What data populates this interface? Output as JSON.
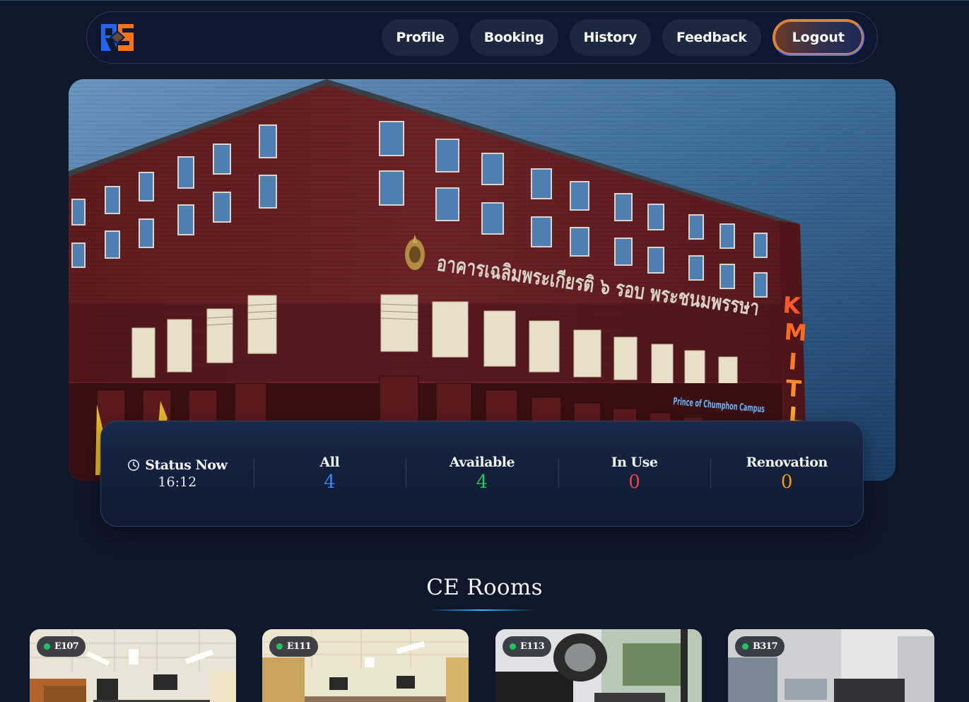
{
  "nav": {
    "logo_alt": "RS",
    "items": [
      {
        "label": "Profile"
      },
      {
        "label": "Booking"
      },
      {
        "label": "History"
      },
      {
        "label": "Feedback"
      }
    ],
    "logout_label": "Logout"
  },
  "hero": {
    "building_sign": "อาคารเฉลิมพระเกียรติ ๖ รอบ พระชนมพรรษา",
    "vertical_sign": "KMITL",
    "campus_sign": "Prince of Chumphon Campus"
  },
  "status": {
    "title": "Status Now",
    "time": "16:12",
    "stats": [
      {
        "label": "All",
        "value": "4",
        "color": "#3b82f6"
      },
      {
        "label": "Available",
        "value": "4",
        "color": "#22c55e"
      },
      {
        "label": "In Use",
        "value": "0",
        "color": "#ef4444"
      },
      {
        "label": "Renovation",
        "value": "0",
        "color": "#f59e0b"
      }
    ]
  },
  "section": {
    "title": "CE Rooms"
  },
  "rooms": [
    {
      "name": "E107",
      "status_color": "#22c55e"
    },
    {
      "name": "E111",
      "status_color": "#22c55e"
    },
    {
      "name": "E113",
      "status_color": "#22c55e"
    },
    {
      "name": "B317",
      "status_color": "#22c55e"
    }
  ]
}
